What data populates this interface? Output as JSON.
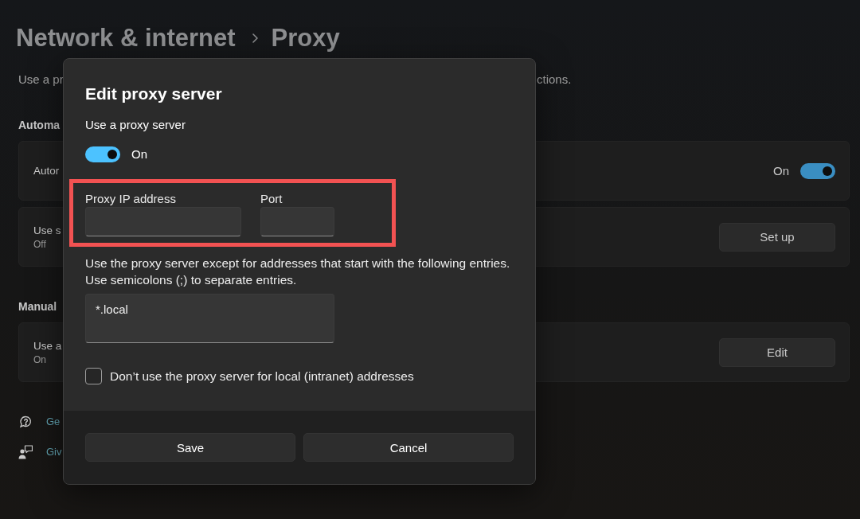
{
  "breadcrumb": {
    "parent": "Network & internet",
    "current": "Proxy"
  },
  "description": {
    "visible_start": "Use a pr",
    "visible_end": "ctions."
  },
  "sections": [
    {
      "heading": "Automa",
      "cards": [
        {
          "kind": "toggle",
          "title": "Autor",
          "state_label": "On",
          "on": true
        },
        {
          "kind": "button",
          "title": "Use s",
          "subtitle": "Off",
          "button": "Set up"
        }
      ]
    },
    {
      "heading": "Manual",
      "cards": [
        {
          "kind": "button",
          "title": "Use a",
          "subtitle": "On",
          "button": "Edit"
        }
      ]
    }
  ],
  "links": [
    {
      "kind": "help",
      "label": "Ge"
    },
    {
      "kind": "feedback",
      "label": "Giv"
    }
  ],
  "dialog": {
    "title": "Edit proxy server",
    "use_proxy": {
      "label": "Use a proxy server",
      "on": true,
      "state_label": "On"
    },
    "address": {
      "highlighted": true,
      "fields": [
        {
          "kind": "address",
          "label": "Proxy IP address"
        },
        {
          "kind": "port",
          "label": "Port"
        }
      ]
    },
    "exceptions": {
      "hint": [
        "Use the proxy server except for addresses that start with the following entries.",
        "Use semicolons (;) to separate entries."
      ],
      "value": "*.local"
    },
    "local_bypass": {
      "label": "Don’t use the proxy server for local (intranet) addresses",
      "checked": false
    },
    "buttons": [
      {
        "label": "Save"
      },
      {
        "label": "Cancel"
      }
    ]
  }
}
